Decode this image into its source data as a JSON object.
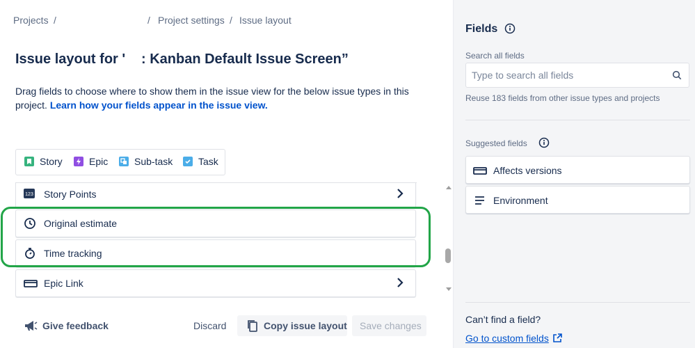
{
  "breadcrumb": {
    "projects": "Projects",
    "sep1": "/",
    "sep2": "/",
    "project_settings": "Project settings",
    "sep3": "/",
    "issue_layout": "Issue layout"
  },
  "title": {
    "prefix": "Issue layout for '",
    "suffix": ": Kanban Default Issue Screen”"
  },
  "description": {
    "text": "Drag fields to choose where to show them in the issue view for the below issue types in this project. ",
    "link": "Learn how your fields appear in the issue view."
  },
  "issue_types": [
    {
      "label": "Story",
      "icon": "story-icon",
      "color": "#36b37e"
    },
    {
      "label": "Epic",
      "icon": "epic-icon",
      "color": "#904ee2"
    },
    {
      "label": "Sub-task",
      "icon": "subtask-icon",
      "color": "#4bade8"
    },
    {
      "label": "Task",
      "icon": "task-icon",
      "color": "#4bade8"
    }
  ],
  "fields": [
    {
      "label": "Story Points",
      "icon": "number-icon",
      "has_chevron": true
    },
    {
      "label": "Original estimate",
      "icon": "clock-icon",
      "has_chevron": false
    },
    {
      "label": "Time tracking",
      "icon": "stopwatch-icon",
      "has_chevron": false
    },
    {
      "label": "Epic Link",
      "icon": "epic-link-icon",
      "has_chevron": true
    }
  ],
  "footer": {
    "feedback": "Give feedback",
    "discard": "Discard",
    "copy": "Copy issue layout",
    "save": "Save changes"
  },
  "sidebar": {
    "title": "Fields",
    "search_label": "Search all fields",
    "search_placeholder": "Type to search all fields",
    "reuse_text": "Reuse 183 fields from other issue types and projects",
    "suggested_label": "Suggested fields",
    "suggested": [
      {
        "label": "Affects versions",
        "icon": "version-icon"
      },
      {
        "label": "Environment",
        "icon": "text-lines-icon"
      }
    ],
    "cant_find": "Can’t find a field?",
    "custom_link": "Go to custom fields"
  },
  "colors": {
    "highlight": "#22a548",
    "link": "#0052cc",
    "sidebar_bg": "#f4f5f7"
  }
}
